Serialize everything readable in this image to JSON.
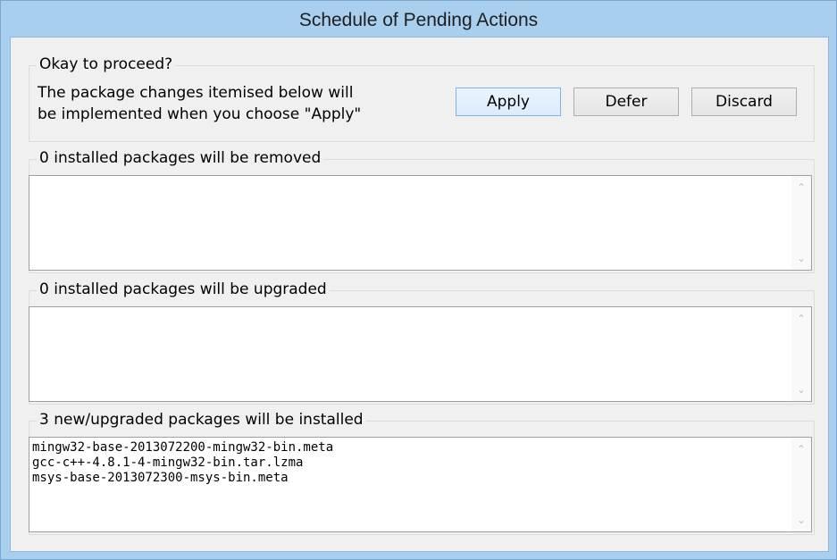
{
  "window": {
    "title": "Schedule of Pending Actions"
  },
  "proceed": {
    "group_label": "Okay to proceed?",
    "description_line1": "The package changes itemised below will",
    "description_line2": "be implemented when you choose \"Apply\"",
    "apply_label": "Apply",
    "defer_label": "Defer",
    "discard_label": "Discard"
  },
  "removed": {
    "group_label": "0 installed packages will be removed",
    "items": []
  },
  "upgraded": {
    "group_label": "0 installed packages will be upgraded",
    "items": []
  },
  "installed": {
    "group_label": "3 new/upgraded packages will be installed",
    "items": [
      "mingw32-base-2013072200-mingw32-bin.meta",
      "gcc-c++-4.8.1-4-mingw32-bin.tar.lzma",
      "msys-base-2013072300-msys-bin.meta"
    ]
  },
  "icons": {
    "scroll_up": "chevron-up-icon",
    "scroll_down": "chevron-down-icon"
  }
}
